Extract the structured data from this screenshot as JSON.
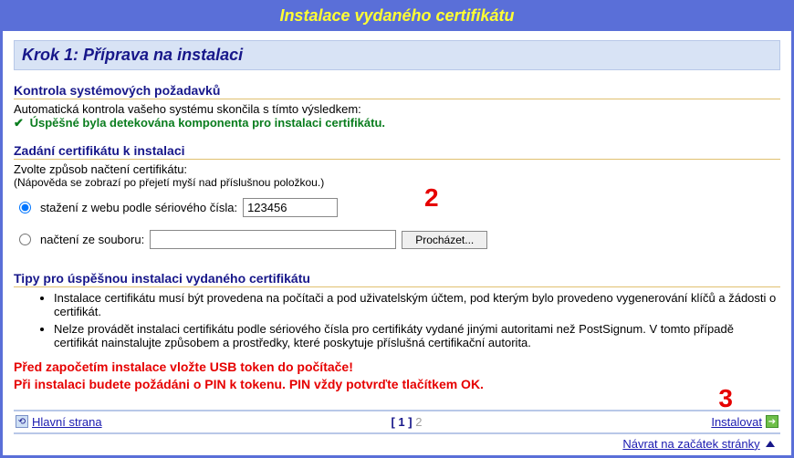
{
  "title": "Instalace vydaného certifikátu",
  "step_header": "Krok 1: Příprava na instalaci",
  "section_check": {
    "heading": "Kontrola systémových požadavků",
    "intro": "Automatická kontrola vašeho systému skončila s tímto výsledkem:",
    "success_msg": "Úspěšné byla detekována komponenta pro instalaci certifikátu."
  },
  "section_input": {
    "heading": "Zadání certifikátu k instalaci",
    "intro": "Zvolte způsob načtení certifikátu:",
    "hint": "(Nápověda se zobrazí po přejetí myší nad příslušnou položkou.)",
    "opt_serial_label": "stažení z webu podle sériového čísla:",
    "serial_value": "123456",
    "opt_file_label": "načtení ze souboru:",
    "file_value": "",
    "browse_btn": "Procházet...",
    "marker_serial": "2"
  },
  "section_tips": {
    "heading": "Tipy pro úspěšnou instalaci vydaného certifikátu",
    "items": [
      "Instalace certifikátu musí být provedena na počítači a pod uživatelským účtem, pod kterým bylo provedeno vygenerování klíčů a žádosti o certifikát.",
      "Nelze provádět instalaci certifikátu podle sériového čísla pro certifikáty vydané jinými autoritami než PostSignum. V tomto případě certifikát nainstalujte způsobem a prostředky, které poskytuje příslušná certifikační autorita."
    ]
  },
  "warnings": {
    "line1": "Před započetím instalace vložte USB token do počítače!",
    "line2": "Při instalaci budete požádáni o PIN k tokenu. PIN vždy potvrďte tlačítkem OK."
  },
  "nav": {
    "home": "Hlavní strana",
    "page_current": "1",
    "page_total": "2",
    "install": "Instalovat",
    "marker_install": "3",
    "back_to_top": "Návrat na začátek stránky"
  }
}
